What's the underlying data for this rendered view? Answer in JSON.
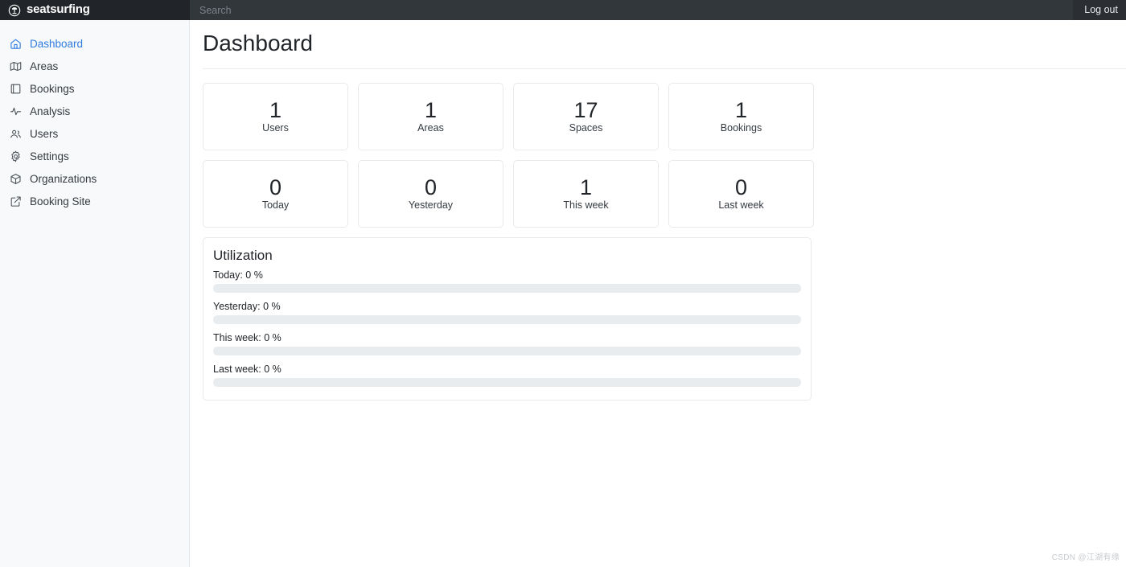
{
  "topbar": {
    "brand": "seatsurfing",
    "brand_icon": "seatsurfing-logo-icon",
    "search_placeholder": "Search",
    "search_value": "",
    "logout_label": "Log out"
  },
  "sidebar": {
    "items": [
      {
        "label": "Dashboard",
        "icon": "home-icon",
        "active": true
      },
      {
        "label": "Areas",
        "icon": "map-icon",
        "active": false
      },
      {
        "label": "Bookings",
        "icon": "book-icon",
        "active": false
      },
      {
        "label": "Analysis",
        "icon": "activity-icon",
        "active": false
      },
      {
        "label": "Users",
        "icon": "users-icon",
        "active": false
      },
      {
        "label": "Settings",
        "icon": "gear-icon",
        "active": false
      },
      {
        "label": "Organizations",
        "icon": "box-icon",
        "active": false
      },
      {
        "label": "Booking Site",
        "icon": "external-link-icon",
        "active": false
      }
    ]
  },
  "main": {
    "page_title": "Dashboard",
    "stats_row_1": [
      {
        "value": "1",
        "label": "Users"
      },
      {
        "value": "1",
        "label": "Areas"
      },
      {
        "value": "17",
        "label": "Spaces"
      },
      {
        "value": "1",
        "label": "Bookings"
      }
    ],
    "stats_row_2": [
      {
        "value": "0",
        "label": "Today"
      },
      {
        "value": "0",
        "label": "Yesterday"
      },
      {
        "value": "1",
        "label": "This week"
      },
      {
        "value": "0",
        "label": "Last week"
      }
    ],
    "utilization": {
      "title": "Utilization",
      "rows": [
        {
          "label": "Today: 0 %",
          "percent": 0
        },
        {
          "label": "Yesterday: 0 %",
          "percent": 0
        },
        {
          "label": "This week: 0 %",
          "percent": 0
        },
        {
          "label": "Last week: 0 %",
          "percent": 0
        }
      ]
    }
  },
  "watermark": "CSDN @江湖有缘",
  "colors": {
    "accent": "#2f7ce0",
    "topbar_bg": "#2b2f33",
    "brand_bg": "#212529",
    "sidebar_bg": "#f8f9fa",
    "card_border": "#e7e9ec",
    "bar_track": "#e9ecef"
  }
}
